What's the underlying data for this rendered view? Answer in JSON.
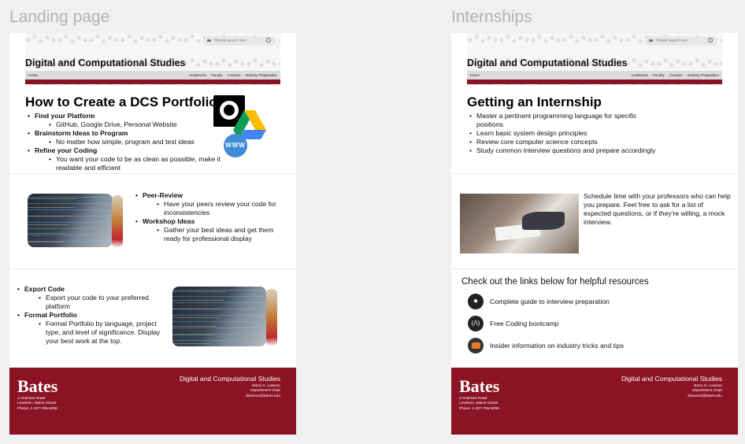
{
  "frames": {
    "landing": {
      "label": "Landing page",
      "header": {
        "search_placeholder": "Hinted search text",
        "site_title": "Digital and Computational Studies",
        "nav_home": "Home",
        "nav_items": [
          "Academics",
          "Faculty",
          "Courses",
          "Industry Preparation"
        ]
      },
      "heading": "How to Create a DCS Portfolio",
      "section1": [
        {
          "title": "Find your Platform",
          "sub": "GitHub, Google Drive, Personal Website"
        },
        {
          "title": "Brainstorm Ideas to Program",
          "sub": "No matter how simple, program and test ideas"
        },
        {
          "title": "Refine your Coding",
          "sub": "You want your code to be as clean as possible, make it readable and efficient"
        }
      ],
      "www_logo": "WWW",
      "section2": [
        {
          "title": "Peer-Review",
          "sub": "Have your peers review your code for inconsistencies"
        },
        {
          "title": "Workshop Ideas",
          "sub": "Gather your best ideas and get them ready for professional display"
        }
      ],
      "section3": [
        {
          "title": "Export Code",
          "sub": "Export your code to your preferred platform"
        },
        {
          "title": "Format Portfolio",
          "sub": "Format Portfolio by language, project type, and level of significance. Display your best work at the top."
        }
      ]
    },
    "internships": {
      "label": "Internships",
      "header": {
        "search_placeholder": "Hinted search text",
        "site_title": "Digital and Computational Studies",
        "nav_home": "Home",
        "nav_items": [
          "Academics",
          "Faculty",
          "Courses",
          "Industry Preparation"
        ]
      },
      "heading": "Getting an Internship",
      "tips": [
        "Master a pertinent programming language for specific positions",
        "Learn basic system design principles",
        "Review core computer science concepts",
        "Study common interview questions and prepare accordingly"
      ],
      "schedule_text": "Schedule time with your professors who can help you prepare. Feel free to ask for a list of expected questions, or if they're willing, a mock interview.",
      "resources_heading": "Check out the links below for helpful resources",
      "resources": [
        {
          "icon": "github-icon",
          "label": "Complete guide to interview preparation"
        },
        {
          "icon": "freecodecamp-icon",
          "label": "Free Coding bootcamp"
        },
        {
          "icon": "codecademy-icon",
          "label": "Insider information on industry tricks and tips"
        }
      ]
    }
  },
  "footer": {
    "brand": "Bates",
    "address": [
      "2 Andrews Road",
      "Lewiston, Maine 04240",
      "Phone: 1-207-786-6255"
    ],
    "dept": "Digital and Computational Studies",
    "contact": [
      "Barry G. Lawson",
      "Department Chair",
      "blawson@bates.edu"
    ]
  },
  "colors": {
    "accent": "#8b1323",
    "background": "#f0f0f0",
    "label": "#b3b3b3"
  }
}
